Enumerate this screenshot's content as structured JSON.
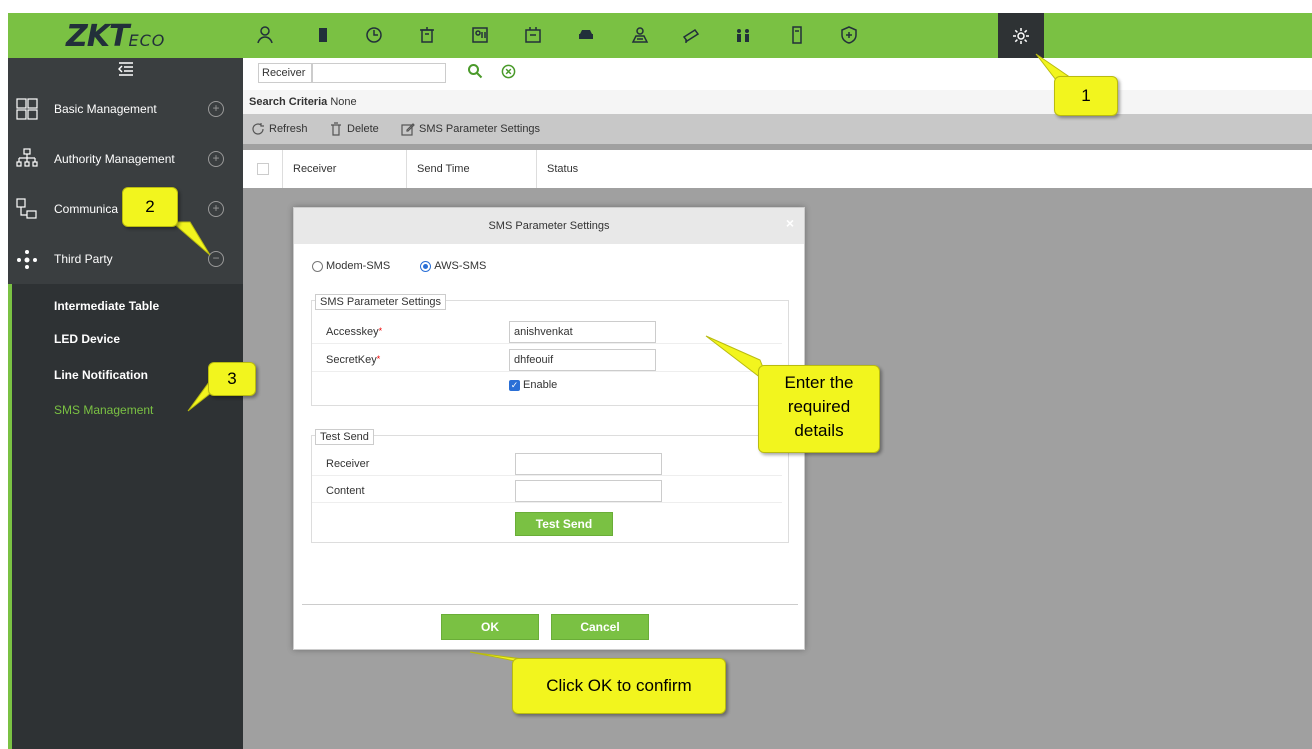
{
  "brand": {
    "logo_main": "ZKT",
    "logo_sub": "ECO"
  },
  "topnav": [
    {
      "icon": "person-icon"
    },
    {
      "icon": "door-icon"
    },
    {
      "icon": "clock-icon"
    },
    {
      "icon": "elevator-icon"
    },
    {
      "icon": "visitor-icon"
    },
    {
      "icon": "parking-board-icon"
    },
    {
      "icon": "car-icon"
    },
    {
      "icon": "patrol-icon"
    },
    {
      "icon": "video-icon"
    },
    {
      "icon": "people-icon"
    },
    {
      "icon": "locker-icon"
    },
    {
      "icon": "shield-plus-icon"
    },
    {
      "icon": "gear-icon",
      "active": true
    }
  ],
  "sidebar": {
    "items": [
      {
        "label": "Basic Management"
      },
      {
        "label": "Authority Management"
      },
      {
        "label": "Communica"
      },
      {
        "label": "Third Party"
      }
    ],
    "subitems": [
      {
        "label": "Intermediate Table"
      },
      {
        "label": "LED Device"
      },
      {
        "label": "Line Notification"
      },
      {
        "label": "SMS Management"
      }
    ]
  },
  "search": {
    "label": "Receiver",
    "value": ""
  },
  "criteria": {
    "label": "Search Criteria",
    "value": "None"
  },
  "toolbar": {
    "refresh": "Refresh",
    "delete": "Delete",
    "sms_settings": "SMS Parameter Settings"
  },
  "table": {
    "columns": [
      "Receiver",
      "Send Time",
      "Status"
    ]
  },
  "dialog": {
    "title": "SMS Parameter Settings",
    "radio_modem": "Modem-SMS",
    "radio_aws": "AWS-SMS",
    "selected": "AWS-SMS",
    "params_legend": "SMS Parameter Settings",
    "accesskey_label": "Accesskey",
    "accesskey_value": "anishvenkat",
    "secretkey_label": "SecretKey",
    "secretkey_value": "dhfeouif",
    "enable_label": "Enable",
    "enable_checked": true,
    "test_legend": "Test Send",
    "receiver_label": "Receiver",
    "content_label": "Content",
    "test_send_button": "Test Send",
    "ok_button": "OK",
    "cancel_button": "Cancel"
  },
  "callouts": {
    "c1": "1",
    "c2": "2",
    "c3": "3",
    "details": "Enter the required details",
    "ok": "Click OK to confirm"
  },
  "colors": {
    "accent": "#7ac143",
    "sidebar": "#2e3234",
    "callout": "#f2f51e"
  }
}
